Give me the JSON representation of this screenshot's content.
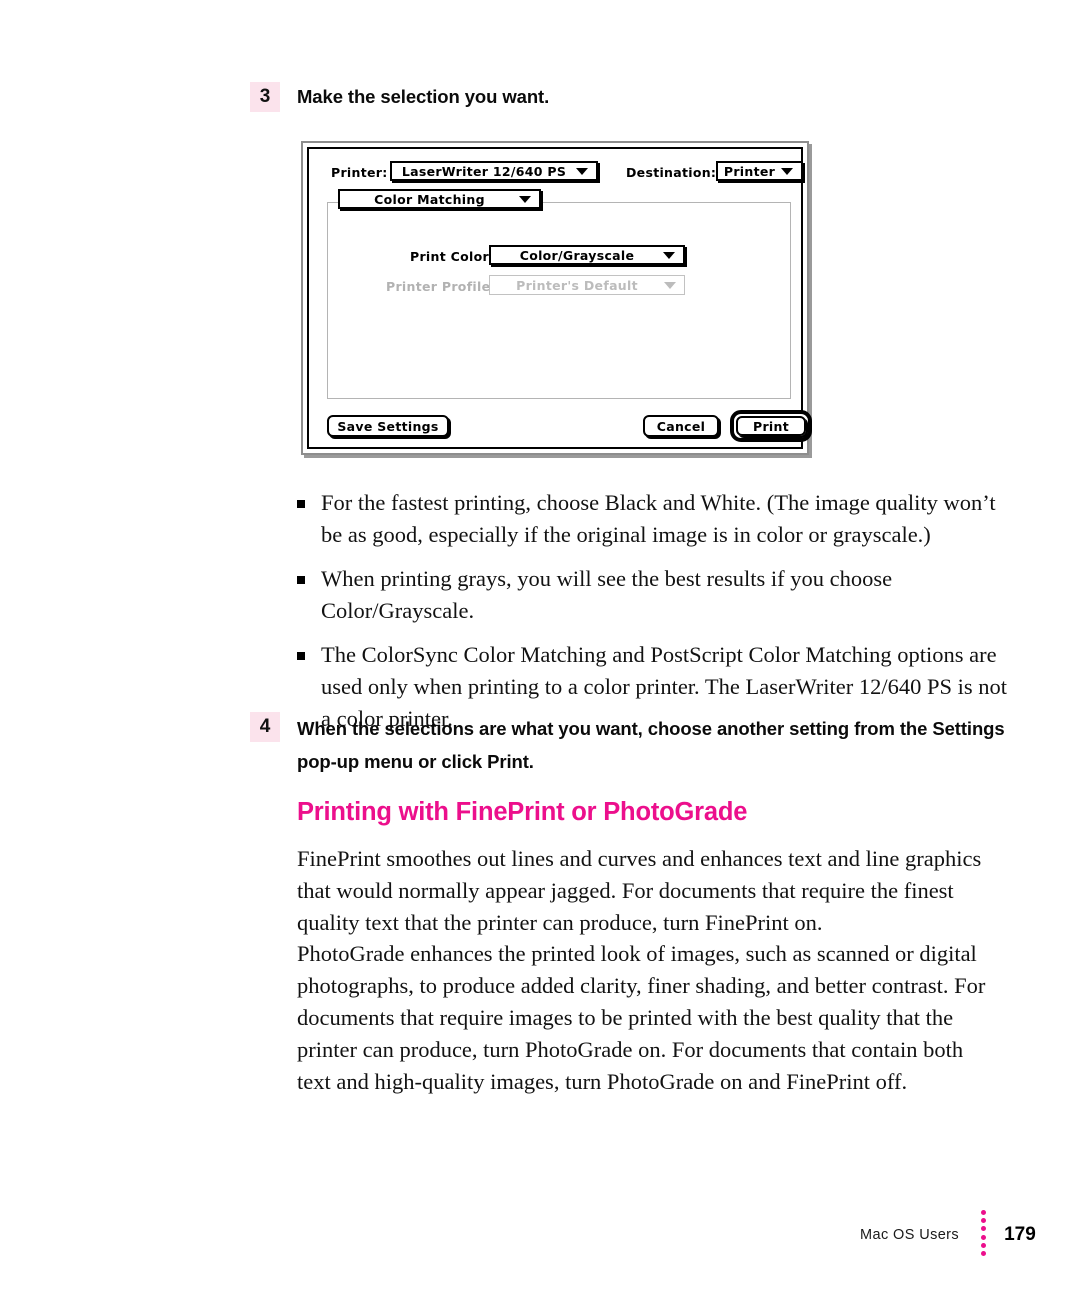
{
  "steps": {
    "step3": {
      "number": "3",
      "text": "Make the selection you want."
    },
    "step4": {
      "number": "4",
      "text": "When the selections are what you want, choose another setting from the Settings pop-up menu or click Print."
    }
  },
  "dialog": {
    "printer_label": "Printer:",
    "printer_value": "LaserWriter 12/640 PS",
    "destination_label": "Destination:",
    "destination_value": "Printer",
    "settings_value": "Color Matching",
    "print_color_label": "Print Color:",
    "print_color_value": "Color/Grayscale",
    "printer_profile_label": "Printer Profile:",
    "printer_profile_value": "Printer's Default",
    "save_settings_button": "Save Settings",
    "cancel_button": "Cancel",
    "print_button": "Print"
  },
  "bullets": [
    "For the fastest printing, choose Black and White. (The image quality won’t be as good, especially if the original image is in color or grayscale.)",
    "When printing grays, you will see the best results if you choose Color/Grayscale.",
    "The ColorSync Color Matching and PostScript Color Matching options are used only when printing to a color printer. The LaserWriter 12/640 PS is not a color printer."
  ],
  "section": {
    "heading": "Printing with FinePrint or PhotoGrade",
    "paragraph_1": "FinePrint smoothes out lines and curves and enhances text and line graphics that would normally appear jagged. For documents that require the finest quality text that the printer can produce, turn FinePrint on.",
    "paragraph_2": "PhotoGrade enhances the printed look of images, such as scanned or digital photographs, to produce added clarity, finer shading, and better contrast. For documents that require images to be printed with the best quality that the printer can produce, turn PhotoGrade on. For documents that contain both text and high-quality images, turn PhotoGrade on and FinePrint off."
  },
  "footer": {
    "label": "Mac OS Users",
    "page_number": "179"
  },
  "colors": {
    "accent_magenta": "#ec0f8c",
    "step_badge_bg": "#fbe3ec",
    "body_text": "#121212"
  }
}
